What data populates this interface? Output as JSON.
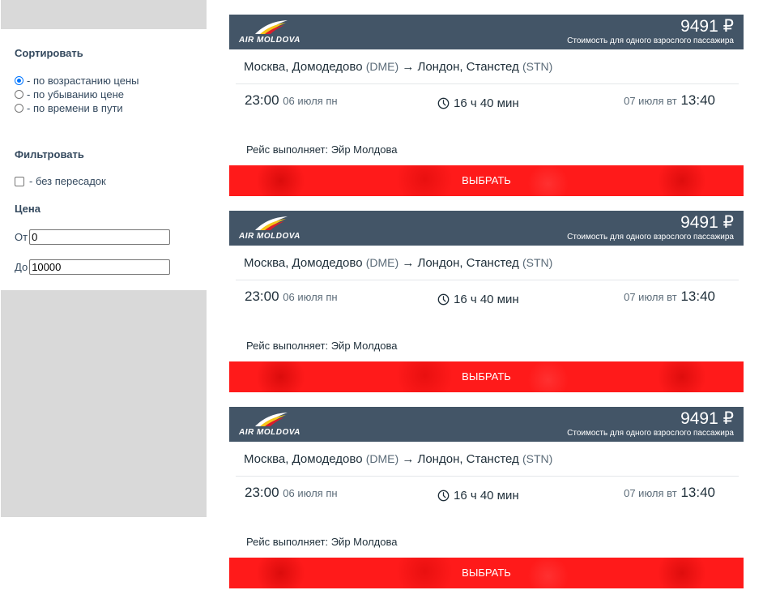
{
  "sidebar": {
    "sort_title": "Сортировать",
    "sort_options": [
      {
        "label": "- по возрастанию цены",
        "checked": true
      },
      {
        "label": "- по убыванию цене",
        "checked": false
      },
      {
        "label": "- по времени в пути",
        "checked": false
      }
    ],
    "filter_title": "Фильтровать",
    "filter_option": {
      "label": "- без пересадок",
      "checked": false
    },
    "price_title": "Цена",
    "price_from_label": "От",
    "price_from_value": "0",
    "price_to_label": "До",
    "price_to_value": "10000"
  },
  "flights": [
    {
      "airline_logo": "AIR MOLDOVA",
      "price": "9491 ₽",
      "price_note": "Стоимость для одного взрослого пассажира",
      "from_city": "Москва, Домодедово",
      "from_code": "(DME)",
      "arrow": "→",
      "to_city": "Лондон, Станстед",
      "to_code": "(STN)",
      "dep_time": "23:00",
      "dep_date": "06 июля пн",
      "duration": "16 ч 40 мин",
      "arr_date": "07 июля вт",
      "arr_time": "13:40",
      "operator": "Рейс выполняет: Эйр Молдова",
      "button": "ВЫБРАТЬ"
    },
    {
      "airline_logo": "AIR MOLDOVA",
      "price": "9491 ₽",
      "price_note": "Стоимость для одного взрослого пассажира",
      "from_city": "Москва, Домодедово",
      "from_code": "(DME)",
      "arrow": "→",
      "to_city": "Лондон, Станстед",
      "to_code": "(STN)",
      "dep_time": "23:00",
      "dep_date": "06 июля пн",
      "duration": "16 ч 40 мин",
      "arr_date": "07 июля вт",
      "arr_time": "13:40",
      "operator": "Рейс выполняет: Эйр Молдова",
      "button": "ВЫБРАТЬ"
    },
    {
      "airline_logo": "AIR MOLDOVA",
      "price": "9491 ₽",
      "price_note": "Стоимость для одного взрослого пассажира",
      "from_city": "Москва, Домодедово",
      "from_code": "(DME)",
      "arrow": "→",
      "to_city": "Лондон, Станстед",
      "to_code": "(STN)",
      "dep_time": "23:00",
      "dep_date": "06 июля пн",
      "duration": "16 ч 40 мин",
      "arr_date": "07 июля вт",
      "arr_time": "13:40",
      "operator": "Рейс выполняет: Эйр Молдова",
      "button": "ВЫБРАТЬ"
    }
  ],
  "colors": {
    "card_header": "#435567",
    "button_red": "#ff1a1a",
    "sidebar_gray": "#d9d9d9",
    "radio_accent": "#0075ff"
  },
  "icons": {
    "duration": "clock-icon",
    "logo": "air-moldova-wing-logo"
  }
}
